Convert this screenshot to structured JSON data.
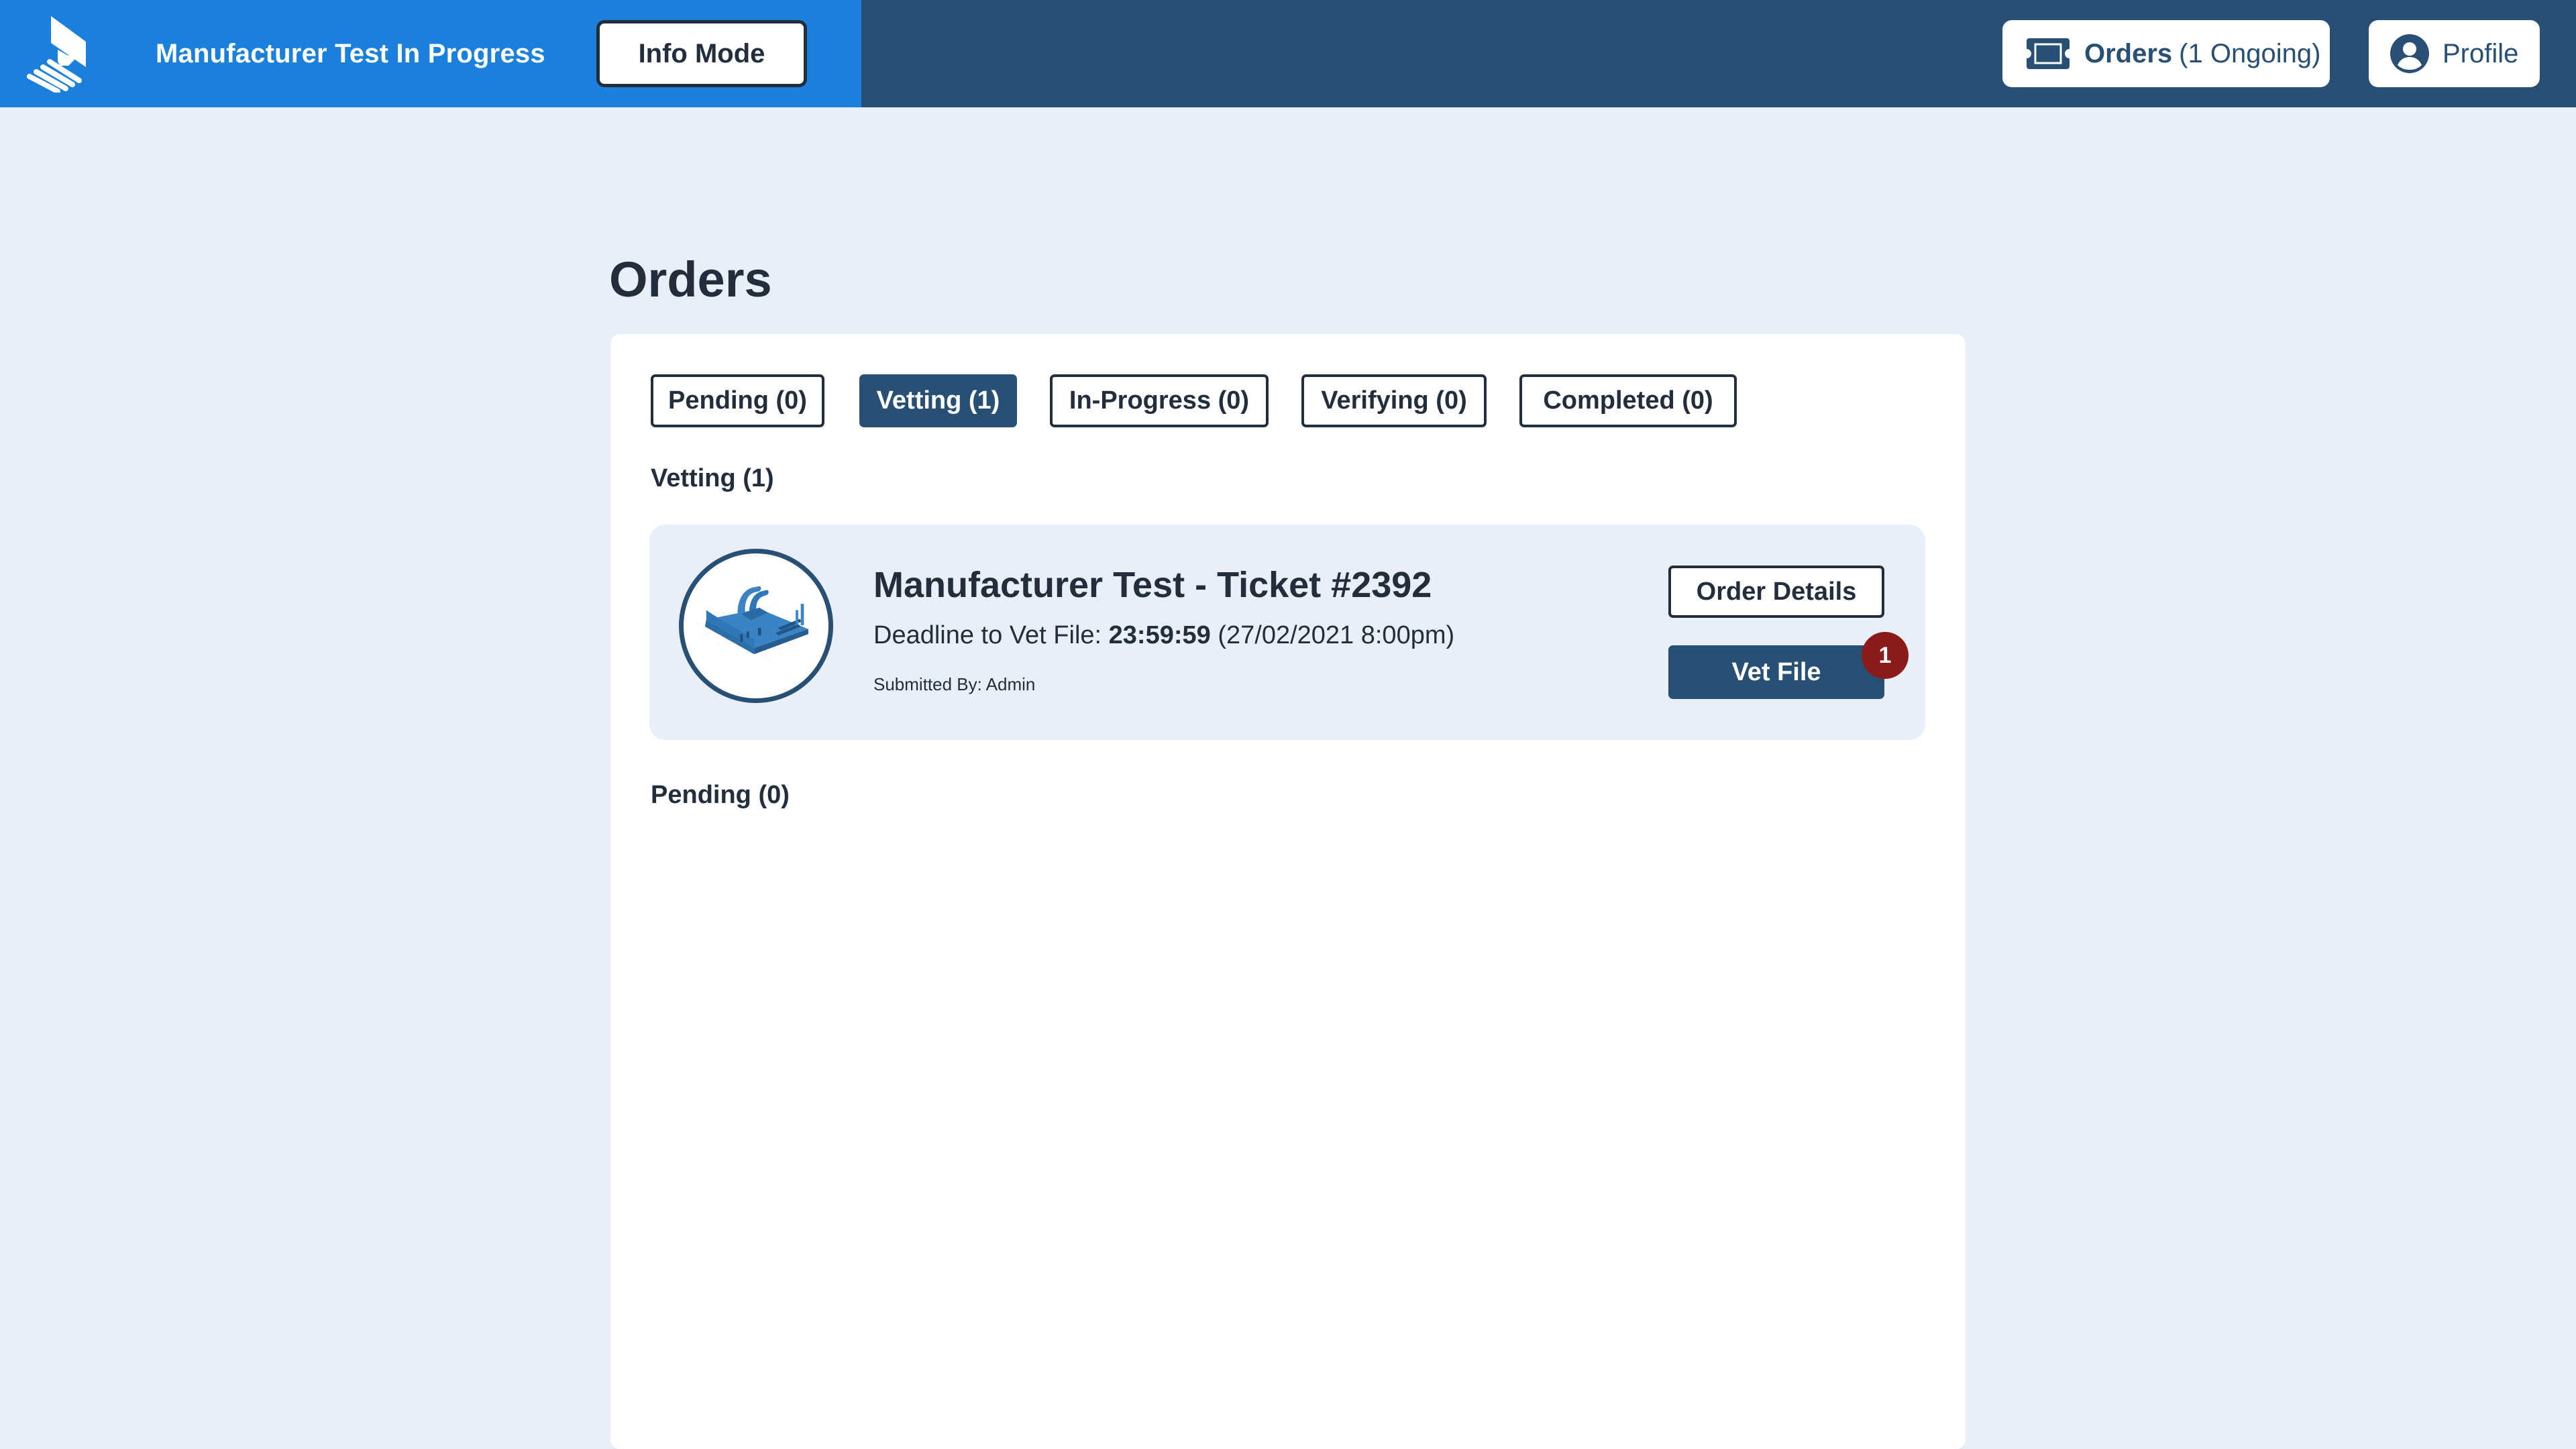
{
  "header": {
    "app_title": "Manufacturer Test In Progress",
    "info_mode_label": "Info Mode",
    "orders_button": {
      "label": "Orders",
      "count_text": "(1 Ongoing)",
      "icon": "ticket-icon"
    },
    "profile_button": {
      "label": "Profile",
      "icon": "user-circle-icon"
    },
    "logo_icon": "3d-printer-logo-icon"
  },
  "page": {
    "title": "Orders"
  },
  "tabs": [
    {
      "label": "Pending (0)",
      "active": false
    },
    {
      "label": "Vetting (1)",
      "active": true
    },
    {
      "label": "In-Progress (0)",
      "active": false
    },
    {
      "label": "Verifying (0)",
      "active": false
    },
    {
      "label": "Completed (0)",
      "active": false
    }
  ],
  "sections": {
    "vetting": {
      "label": "Vetting (1)",
      "orders": [
        {
          "title": "Manufacturer Test - Ticket #2392",
          "deadline_label": "Deadline to Vet File:",
          "deadline_countdown": "23:59:59",
          "deadline_datetime": "(27/02/2021 8:00pm)",
          "submitted_by": "Submitted By: Admin",
          "order_details_label": "Order Details",
          "vet_file_label": "Vet File",
          "vet_file_badge": "1"
        }
      ]
    },
    "pending": {
      "label": "Pending (0)"
    }
  },
  "colors": {
    "header_accent": "#1a80db",
    "header_dark": "#284f74",
    "page_background": "#e8eff8",
    "text_dark": "#222e3b",
    "badge_red": "#8b1a1a"
  }
}
